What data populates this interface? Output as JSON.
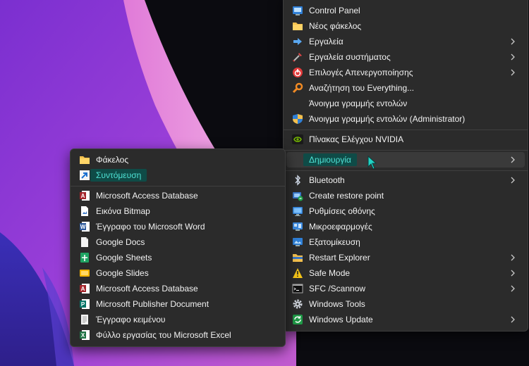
{
  "main_menu": {
    "items": [
      {
        "label": "Control Panel",
        "icon": "control-panel-icon"
      },
      {
        "label": "Νέος φάκελος",
        "icon": "folder-icon"
      },
      {
        "label": "Εργαλεία",
        "icon": "arrow-right-icon",
        "submenu": true
      },
      {
        "label": "Εργαλεία συστήματος",
        "icon": "tools-icon",
        "submenu": true
      },
      {
        "label": "Επιλογές Απενεργοποίησης",
        "icon": "power-icon",
        "submenu": true
      },
      {
        "label": "Αναζήτηση του Everything...",
        "icon": "magnifier-icon"
      },
      {
        "label": "Άνοιγμα γραμμής εντολών",
        "icon": ""
      },
      {
        "label": "Άνοιγμα γραμμής εντολών (Administrator)",
        "icon": "shield-icon"
      },
      {
        "label": "Πίνακας Ελέγχου NVIDIA",
        "icon": "nvidia-icon"
      },
      {
        "label": "Δημιουργία",
        "icon": "",
        "submenu": true,
        "highlighted": true
      },
      {
        "label": "Bluetooth",
        "icon": "bluetooth-icon",
        "submenu": true
      },
      {
        "label": "Create restore point",
        "icon": "restore-point-icon"
      },
      {
        "label": "Ρυθμίσεις οθόνης",
        "icon": "display-icon"
      },
      {
        "label": "Μικροεφαρμογές",
        "icon": "widgets-icon"
      },
      {
        "label": "Εξατομίκευση",
        "icon": "personalize-icon"
      },
      {
        "label": "Restart Explorer",
        "icon": "explorer-icon",
        "submenu": true
      },
      {
        "label": "Safe Mode",
        "icon": "warning-icon",
        "submenu": true
      },
      {
        "label": "SFC /Scannow",
        "icon": "cmd-icon",
        "submenu": true
      },
      {
        "label": "Windows Tools",
        "icon": "gear-icon"
      },
      {
        "label": "Windows Update",
        "icon": "update-icon",
        "submenu": true
      }
    ]
  },
  "sub_menu": {
    "items": [
      {
        "label": "Φάκελος",
        "icon": "folder-icon"
      },
      {
        "label": "Συντόμευση",
        "icon": "shortcut-icon",
        "selected": true
      },
      {
        "label": "Microsoft Access Database",
        "icon": "access-icon"
      },
      {
        "label": "Εικόνα Bitmap",
        "icon": "bitmap-icon"
      },
      {
        "label": "Έγγραφο του Microsoft Word",
        "icon": "word-icon"
      },
      {
        "label": "Google Docs",
        "icon": "google-docs-icon"
      },
      {
        "label": "Google Sheets",
        "icon": "google-sheets-icon"
      },
      {
        "label": "Google Slides",
        "icon": "google-slides-icon"
      },
      {
        "label": "Microsoft Access Database",
        "icon": "access-icon"
      },
      {
        "label": "Microsoft Publisher Document",
        "icon": "publisher-icon"
      },
      {
        "label": "Έγγραφο κειμένου",
        "icon": "text-document-icon"
      },
      {
        "label": "Φύλλο εργασίας του Microsoft Excel",
        "icon": "excel-icon"
      }
    ]
  },
  "colors": {
    "menu_bg": "#2b2b2b",
    "highlight_bg": "#3a3a3a",
    "selected_bg": "#0f4b47",
    "selected_text": "#4fe3d6"
  }
}
